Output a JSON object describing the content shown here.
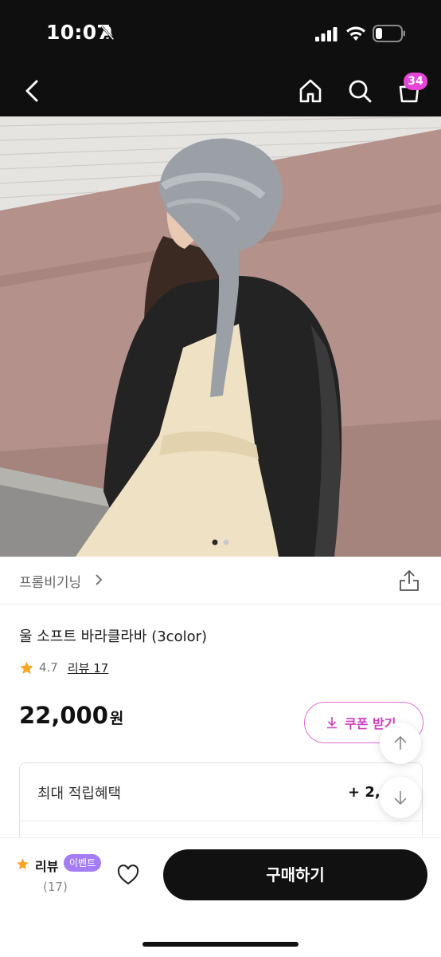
{
  "status_bar": {
    "time": "10:07",
    "icons": [
      "bell-slash-icon",
      "signal-icon",
      "wifi-icon",
      "battery-icon"
    ]
  },
  "nav": {
    "icons": [
      "back-icon",
      "home-icon",
      "search-icon",
      "cart-icon"
    ],
    "cart_count": "34",
    "badge_color": "#e645d7"
  },
  "hero": {
    "image_count": 2,
    "active_index": 0
  },
  "store": {
    "name": "프롬비기닝",
    "chevron": ">"
  },
  "product": {
    "title": "울 소프트 바라클라바 (3color)",
    "rating": "4.7",
    "review_link": "리뷰 17",
    "price": "22,000",
    "price_unit": "원"
  },
  "coupon": {
    "label": "쿠폰 받기",
    "color": "#d13fc2"
  },
  "benefits": {
    "label": "최대 적립혜택",
    "value": "+ 2,1"
  },
  "bottom_bar": {
    "review_label": "리뷰",
    "event_badge": "이벤트",
    "review_count": "(17)",
    "buy_label": "구매하기",
    "accent_star": "#f5a623",
    "badge_color": "#a47cf5"
  }
}
